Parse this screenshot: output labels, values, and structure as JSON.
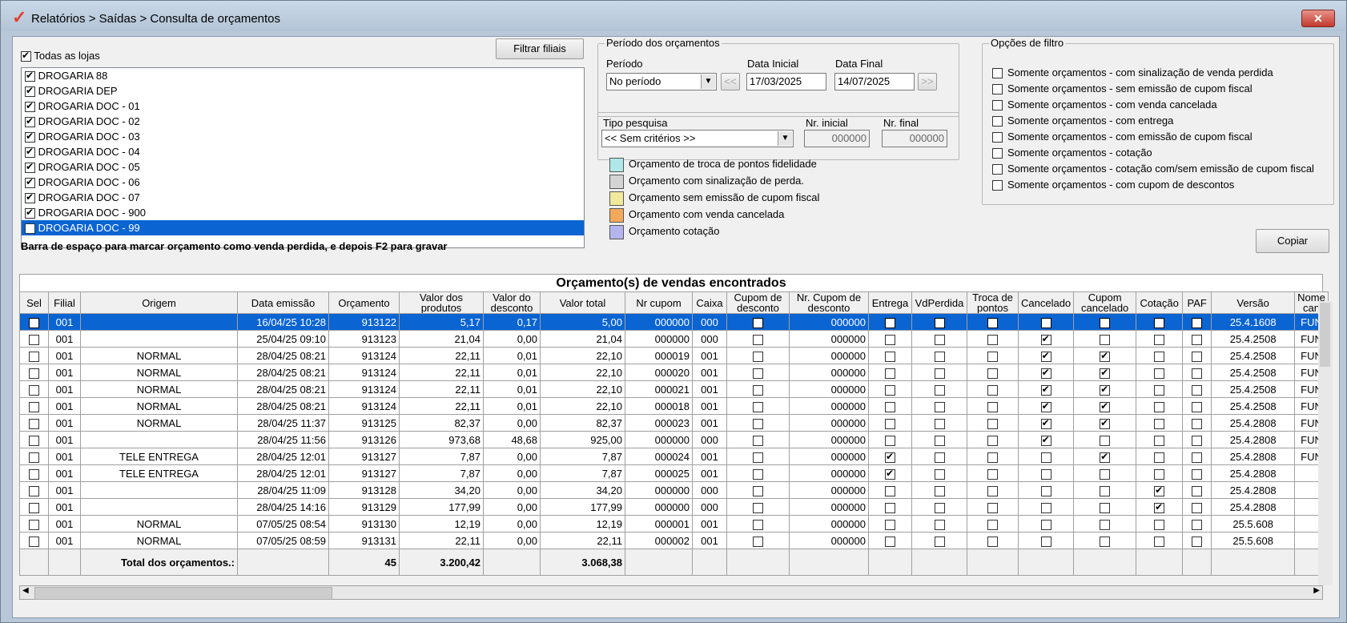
{
  "window": {
    "title": "Relatórios > Saídas > Consulta de orçamentos"
  },
  "stores": {
    "all_label": "Todas as lojas",
    "all_checked": true,
    "filter_button": "Filtrar filiais",
    "items": [
      {
        "label": "DROGARIA 88",
        "checked": true,
        "selected": false
      },
      {
        "label": "DROGARIA DEP",
        "checked": true,
        "selected": false
      },
      {
        "label": "DROGARIA DOC - 01",
        "checked": true,
        "selected": false
      },
      {
        "label": "DROGARIA DOC - 02",
        "checked": true,
        "selected": false
      },
      {
        "label": "DROGARIA DOC - 03",
        "checked": true,
        "selected": false
      },
      {
        "label": "DROGARIA DOC - 04",
        "checked": true,
        "selected": false
      },
      {
        "label": "DROGARIA DOC - 05",
        "checked": true,
        "selected": false
      },
      {
        "label": "DROGARIA DOC - 06",
        "checked": true,
        "selected": false
      },
      {
        "label": "DROGARIA DOC - 07",
        "checked": true,
        "selected": false
      },
      {
        "label": "DROGARIA DOC - 900",
        "checked": true,
        "selected": false
      },
      {
        "label": "DROGARIA DOC - 99",
        "checked": true,
        "selected": true
      }
    ]
  },
  "periodo": {
    "group_title": "Período dos orçamentos",
    "periodo_label": "Período",
    "periodo_value": "No período",
    "data_inicial_label": "Data Inicial",
    "data_inicial": "17/03/2025",
    "data_final_label": "Data Final",
    "data_final": "14/07/2025",
    "prev_label": "<<",
    "next_label": ">>"
  },
  "pesquisa": {
    "tipo_label": "Tipo pesquisa",
    "tipo_value": "<< Sem critérios >>",
    "nr_inicial_label": "Nr. inicial",
    "nr_inicial": "000000",
    "nr_final_label": "Nr. final",
    "nr_final": "000000"
  },
  "legend": [
    {
      "label": "Orçamento de troca de pontos fidelidade",
      "color": "#aee8e8"
    },
    {
      "label": "Orçamento com sinalização de perda.",
      "color": "#d4d4d4"
    },
    {
      "label": "Orçamento sem emissão de cupom fiscal",
      "color": "#f0ea9c"
    },
    {
      "label": "Orçamento com venda cancelada",
      "color": "#f3a95a"
    },
    {
      "label": "Orçamento cotação",
      "color": "#b4b4ee"
    }
  ],
  "filtro": {
    "group_title": "Opções de filtro",
    "options": [
      "Somente orçamentos - com sinalização de venda perdida",
      "Somente orçamentos - sem emissão de cupom fiscal",
      "Somente orçamentos - com venda cancelada",
      "Somente orçamentos - com entrega",
      "Somente orçamentos - com emissão de cupom fiscal",
      "Somente orçamentos - cotação",
      "Somente orçamentos - cotação com/sem emissão de cupom fiscal",
      "Somente orçamentos - com cupom de descontos"
    ]
  },
  "hint": "Barra de espaço para marcar orçamento como venda perdida, e depois F2 para gravar",
  "copy_button": "Copiar",
  "grid": {
    "caption": "Orçamento(s) de vendas encontrados",
    "headers": [
      "Sel",
      "Filial",
      "Origem",
      "Data emissão",
      "Orçamento",
      "Valor dos produtos",
      "Valor do desconto",
      "Valor total",
      "Nr cupom",
      "Caixa",
      "Cupom de desconto",
      "Nr. Cupom de desconto",
      "Entrega",
      "VdPerdida",
      "Troca de pontos",
      "Cancelado",
      "Cupom cancelado",
      "Cotação",
      "PAF",
      "Versão",
      "Nome can"
    ],
    "rows": [
      {
        "filial": "001",
        "origem": "",
        "data": "16/04/25 10:28",
        "orc": "913122",
        "vprod": "5,17",
        "vdesc": "0,17",
        "vtot": "5,00",
        "cupom": "000000",
        "caixa": "000",
        "cdesc": false,
        "nrcd": "000000",
        "entrega": false,
        "vdp": false,
        "troca": false,
        "canc": true,
        "cupcanc": false,
        "cot": false,
        "paf": false,
        "versao": "25.4.1608",
        "nome": "FUN",
        "selected": true
      },
      {
        "filial": "001",
        "origem": "",
        "data": "25/04/25 09:10",
        "orc": "913123",
        "vprod": "21,04",
        "vdesc": "0,00",
        "vtot": "21,04",
        "cupom": "000000",
        "caixa": "000",
        "cdesc": false,
        "nrcd": "000000",
        "entrega": false,
        "vdp": false,
        "troca": false,
        "canc": true,
        "cupcanc": false,
        "cot": false,
        "paf": false,
        "versao": "25.4.2508",
        "nome": "FUN",
        "selected": false
      },
      {
        "filial": "001",
        "origem": "NORMAL",
        "data": "28/04/25 08:21",
        "orc": "913124",
        "vprod": "22,11",
        "vdesc": "0,01",
        "vtot": "22,10",
        "cupom": "000019",
        "caixa": "001",
        "cdesc": false,
        "nrcd": "000000",
        "entrega": false,
        "vdp": false,
        "troca": false,
        "canc": true,
        "cupcanc": true,
        "cot": false,
        "paf": false,
        "versao": "25.4.2508",
        "nome": "FUN",
        "selected": false
      },
      {
        "filial": "001",
        "origem": "NORMAL",
        "data": "28/04/25 08:21",
        "orc": "913124",
        "vprod": "22,11",
        "vdesc": "0,01",
        "vtot": "22,10",
        "cupom": "000020",
        "caixa": "001",
        "cdesc": false,
        "nrcd": "000000",
        "entrega": false,
        "vdp": false,
        "troca": false,
        "canc": true,
        "cupcanc": true,
        "cot": false,
        "paf": false,
        "versao": "25.4.2508",
        "nome": "FUN",
        "selected": false
      },
      {
        "filial": "001",
        "origem": "NORMAL",
        "data": "28/04/25 08:21",
        "orc": "913124",
        "vprod": "22,11",
        "vdesc": "0,01",
        "vtot": "22,10",
        "cupom": "000021",
        "caixa": "001",
        "cdesc": false,
        "nrcd": "000000",
        "entrega": false,
        "vdp": false,
        "troca": false,
        "canc": true,
        "cupcanc": true,
        "cot": false,
        "paf": false,
        "versao": "25.4.2508",
        "nome": "FUN",
        "selected": false
      },
      {
        "filial": "001",
        "origem": "NORMAL",
        "data": "28/04/25 08:21",
        "orc": "913124",
        "vprod": "22,11",
        "vdesc": "0,01",
        "vtot": "22,10",
        "cupom": "000018",
        "caixa": "001",
        "cdesc": false,
        "nrcd": "000000",
        "entrega": false,
        "vdp": false,
        "troca": false,
        "canc": true,
        "cupcanc": true,
        "cot": false,
        "paf": false,
        "versao": "25.4.2508",
        "nome": "FUN",
        "selected": false
      },
      {
        "filial": "001",
        "origem": "NORMAL",
        "data": "28/04/25 11:37",
        "orc": "913125",
        "vprod": "82,37",
        "vdesc": "0,00",
        "vtot": "82,37",
        "cupom": "000023",
        "caixa": "001",
        "cdesc": false,
        "nrcd": "000000",
        "entrega": false,
        "vdp": false,
        "troca": false,
        "canc": true,
        "cupcanc": true,
        "cot": false,
        "paf": false,
        "versao": "25.4.2808",
        "nome": "FUN",
        "selected": false
      },
      {
        "filial": "001",
        "origem": "",
        "data": "28/04/25 11:56",
        "orc": "913126",
        "vprod": "973,68",
        "vdesc": "48,68",
        "vtot": "925,00",
        "cupom": "000000",
        "caixa": "000",
        "cdesc": false,
        "nrcd": "000000",
        "entrega": false,
        "vdp": false,
        "troca": false,
        "canc": true,
        "cupcanc": false,
        "cot": false,
        "paf": false,
        "versao": "25.4.2808",
        "nome": "FUN",
        "selected": false
      },
      {
        "filial": "001",
        "origem": "TELE ENTREGA",
        "data": "28/04/25 12:01",
        "orc": "913127",
        "vprod": "7,87",
        "vdesc": "0,00",
        "vtot": "7,87",
        "cupom": "000024",
        "caixa": "001",
        "cdesc": false,
        "nrcd": "000000",
        "entrega": true,
        "vdp": false,
        "troca": false,
        "canc": false,
        "cupcanc": true,
        "cot": false,
        "paf": false,
        "versao": "25.4.2808",
        "nome": "FUN",
        "selected": false
      },
      {
        "filial": "001",
        "origem": "TELE ENTREGA",
        "data": "28/04/25 12:01",
        "orc": "913127",
        "vprod": "7,87",
        "vdesc": "0,00",
        "vtot": "7,87",
        "cupom": "000025",
        "caixa": "001",
        "cdesc": false,
        "nrcd": "000000",
        "entrega": true,
        "vdp": false,
        "troca": false,
        "canc": false,
        "cupcanc": false,
        "cot": false,
        "paf": false,
        "versao": "25.4.2808",
        "nome": "",
        "selected": false
      },
      {
        "filial": "001",
        "origem": "",
        "data": "28/04/25 11:09",
        "orc": "913128",
        "vprod": "34,20",
        "vdesc": "0,00",
        "vtot": "34,20",
        "cupom": "000000",
        "caixa": "000",
        "cdesc": false,
        "nrcd": "000000",
        "entrega": false,
        "vdp": false,
        "troca": false,
        "canc": false,
        "cupcanc": false,
        "cot": true,
        "paf": false,
        "versao": "25.4.2808",
        "nome": "",
        "selected": false
      },
      {
        "filial": "001",
        "origem": "",
        "data": "28/04/25 14:16",
        "orc": "913129",
        "vprod": "177,99",
        "vdesc": "0,00",
        "vtot": "177,99",
        "cupom": "000000",
        "caixa": "000",
        "cdesc": false,
        "nrcd": "000000",
        "entrega": false,
        "vdp": false,
        "troca": false,
        "canc": false,
        "cupcanc": false,
        "cot": true,
        "paf": false,
        "versao": "25.4.2808",
        "nome": "",
        "selected": false
      },
      {
        "filial": "001",
        "origem": "NORMAL",
        "data": "07/05/25 08:54",
        "orc": "913130",
        "vprod": "12,19",
        "vdesc": "0,00",
        "vtot": "12,19",
        "cupom": "000001",
        "caixa": "001",
        "cdesc": false,
        "nrcd": "000000",
        "entrega": false,
        "vdp": false,
        "troca": false,
        "canc": false,
        "cupcanc": false,
        "cot": false,
        "paf": false,
        "versao": "25.5.608",
        "nome": "",
        "selected": false
      },
      {
        "filial": "001",
        "origem": "NORMAL",
        "data": "07/05/25 08:59",
        "orc": "913131",
        "vprod": "22,11",
        "vdesc": "0,00",
        "vtot": "22,11",
        "cupom": "000002",
        "caixa": "001",
        "cdesc": false,
        "nrcd": "000000",
        "entrega": false,
        "vdp": false,
        "troca": false,
        "canc": false,
        "cupcanc": false,
        "cot": false,
        "paf": false,
        "versao": "25.5.608",
        "nome": "",
        "selected": false
      }
    ],
    "total_label": "Total dos orçamentos.:",
    "total_count": "45",
    "total_vprod": "3.200,42",
    "total_vtot": "3.068,38"
  },
  "colors": {
    "selection": "#0a64d2",
    "titlebar": "#b9c8d8"
  }
}
